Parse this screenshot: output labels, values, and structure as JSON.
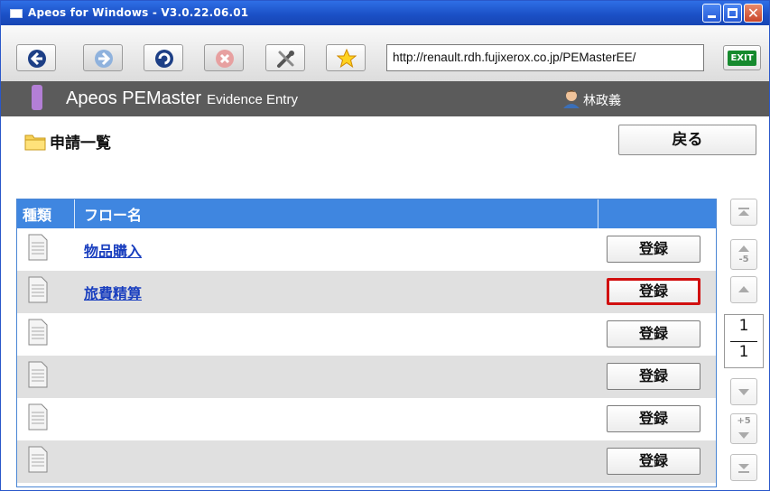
{
  "window": {
    "title": "Apeos for Windows - V3.0.22.06.01"
  },
  "toolbar": {
    "url": "http://renault.rdh.fujixerox.co.jp/PEMasterEE/",
    "exit_label": "EXIT"
  },
  "header": {
    "brand": "Apeos PEMaster",
    "sub": "Evidence Entry",
    "user": "林政義"
  },
  "page": {
    "title": "申請一覧",
    "back_label": "戻る"
  },
  "table": {
    "columns": [
      "種類",
      "フロー名"
    ],
    "rows": [
      {
        "name": "物品購入",
        "button": "登録"
      },
      {
        "name": "旅費精算",
        "button": "登録"
      },
      {
        "name": "",
        "button": "登録"
      },
      {
        "name": "",
        "button": "登録"
      },
      {
        "name": "",
        "button": "登録"
      },
      {
        "name": "",
        "button": "登録"
      }
    ]
  },
  "pager": {
    "prev_step": "-5",
    "next_step": "+5",
    "current": "1",
    "total": "1"
  },
  "colors": {
    "titlebar": "#1a4fc4",
    "header_bg": "#5b5b5b",
    "table_header": "#3f86e0",
    "link": "#1a3fbf",
    "focus_border": "#d10f0f"
  }
}
